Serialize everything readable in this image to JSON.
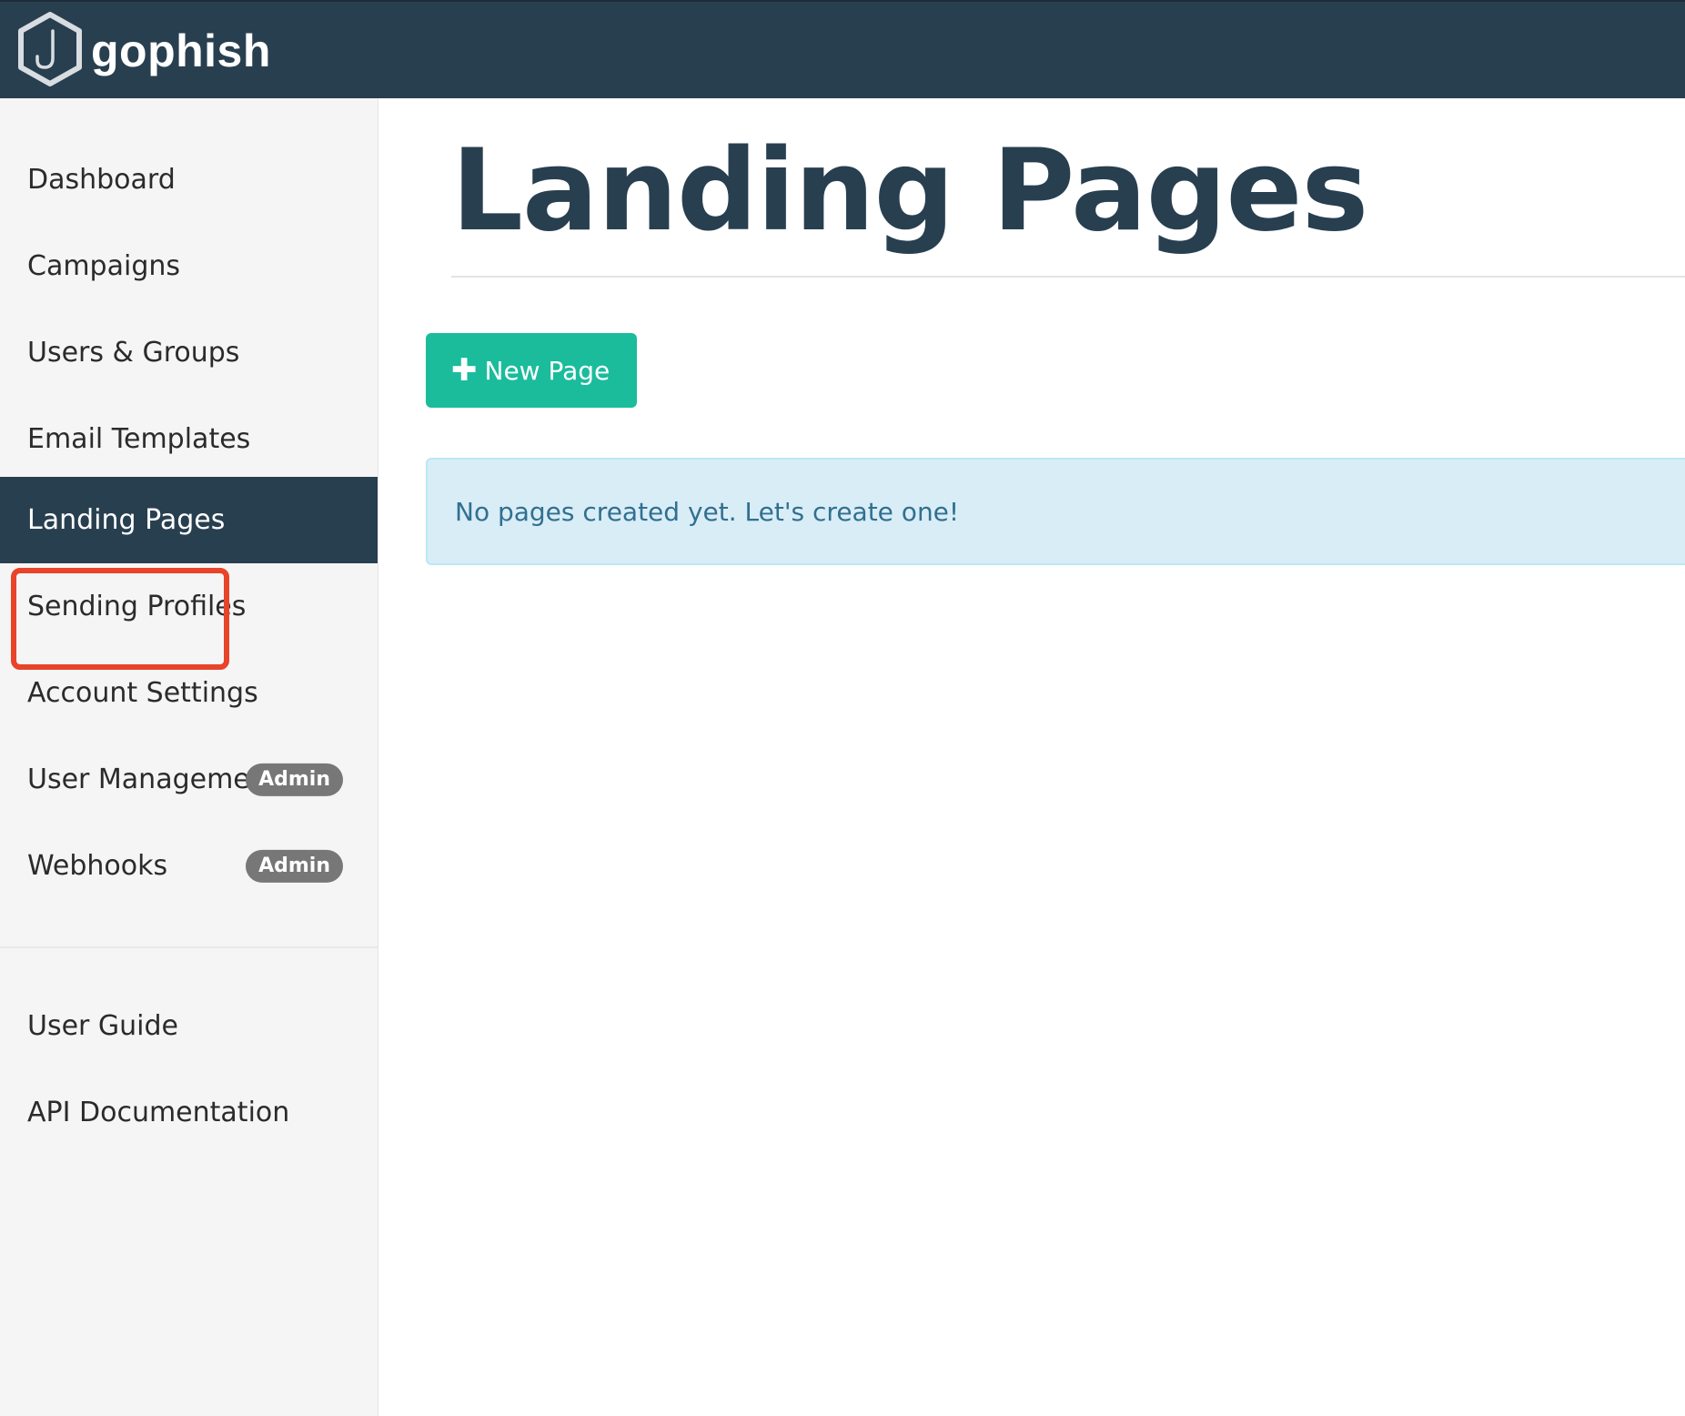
{
  "navbar": {
    "brand": "gophish",
    "background_color": "#283f50",
    "logo_icon": "hexagon-hook-icon"
  },
  "sidebar": {
    "items": [
      {
        "label": "Dashboard"
      },
      {
        "label": "Campaigns"
      },
      {
        "label": "Users & Groups"
      },
      {
        "label": "Email Templates"
      },
      {
        "label": "Landing Pages",
        "active": true
      },
      {
        "label": "Sending Profiles"
      },
      {
        "label": "Account Settings"
      },
      {
        "label": "User Management",
        "badge": "Admin"
      },
      {
        "label": "Webhooks",
        "badge": "Admin"
      }
    ],
    "footer_items": [
      {
        "label": "User Guide"
      },
      {
        "label": "API Documentation"
      }
    ],
    "highlight_color": "#e8442a"
  },
  "main": {
    "title": "Landing Pages",
    "new_button": {
      "label": "New Page",
      "icon": "plus-icon",
      "color": "#1abc9c"
    },
    "empty_alert": "No pages created yet. Let's create one!"
  }
}
